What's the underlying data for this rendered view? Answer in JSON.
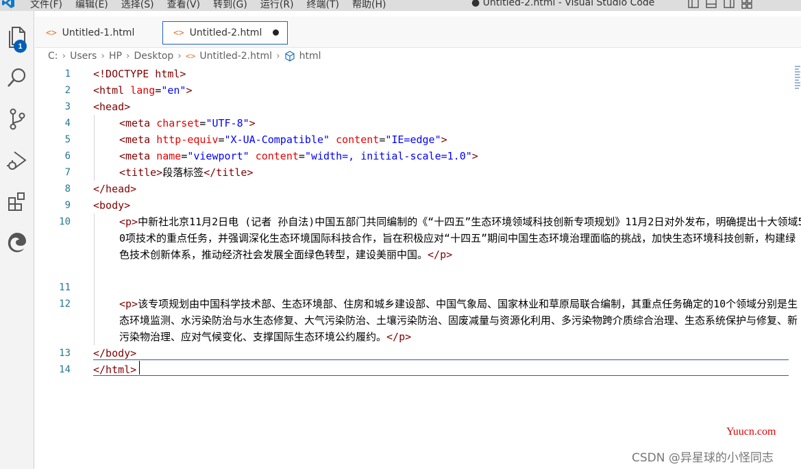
{
  "menu": [
    "文件(F)",
    "编辑(E)",
    "选择(S)",
    "查看(V)",
    "转到(G)",
    "运行(R)",
    "终端(T)",
    "帮助(H)"
  ],
  "window_title": "● Untitled-2.html - Visual Studio Code",
  "activity": {
    "explorer_badge": "1",
    "icons": [
      "files-icon",
      "search-icon",
      "source-control-icon",
      "run-debug-icon",
      "extensions-icon",
      "edge-icon"
    ]
  },
  "tabs": [
    {
      "label": "Untitled-1.html",
      "active": false,
      "dirty": false
    },
    {
      "label": "Untitled-2.html",
      "active": true,
      "dirty": true
    }
  ],
  "breadcrumb": [
    "C:",
    "Users",
    "HP",
    "Desktop",
    "Untitled-2.html",
    "html"
  ],
  "code": {
    "line_numbers": [
      "1",
      "2",
      "3",
      "4",
      "5",
      "6",
      "7",
      "8",
      "9",
      "10",
      "11",
      "12",
      "13",
      "14"
    ],
    "l1": "<!DOCTYPE html>",
    "l2_tag": "<html ",
    "l2_attr": "lang",
    "l2_val": "\"en\"",
    "l3": "<head>",
    "l4_tag": "<meta ",
    "l4_attr": "charset",
    "l4_val": "\"UTF-8\"",
    "l5_tag": "<meta ",
    "l5_attr1": "http-equiv",
    "l5_val1": "\"X-UA-Compatible\"",
    "l5_attr2": "content",
    "l5_val2": "\"IE=edge\"",
    "l6_tag": "<meta ",
    "l6_attr1": "name",
    "l6_val1": "\"viewport\"",
    "l6_attr2": "content",
    "l6_val2": "\"width=, initial-scale=1.0\"",
    "l7_open": "<title>",
    "l7_text": "段落标签",
    "l7_close": "</title>",
    "l8": "</head>",
    "l9": "<body>",
    "p1_open": "<p>",
    "p1_text": "中新社北京11月2日电 (记者 孙自法)中国五部门共同编制的《“十四五”生态环境领域科技创新专项规划》11月2日对外发布，明确提出十大领域50项技术的重点任务，并强调深化生态环境国际科技合作，旨在积极应对“十四五”期间中国生态环境治理面临的挑战，加快生态环境科技创新，构建绿色技术创新体系，推动经济社会发展全面绿色转型，建设美丽中国。",
    "p1_close": "</p>",
    "p2_open": "<p>",
    "p2_text": "该专项规划由中国科学技术部、生态环境部、住房和城乡建设部、中国气象局、国家林业和草原局联合编制，其重点任务确定的10个领域分别是生态环境监测、水污染防治与水生态修复、大气污染防治、土壤污染防治、固废减量与资源化利用、多污染物跨介质综合治理、生态系统保护与修复、新污染物治理、应对气候变化、支撑国际生态环境公约履约。",
    "p2_close": "</p>",
    "l13": "</body>",
    "l14": "</html>"
  },
  "watermark": {
    "site": "Yuucn.com",
    "author": "CSDN @异星球的小怪同志"
  }
}
